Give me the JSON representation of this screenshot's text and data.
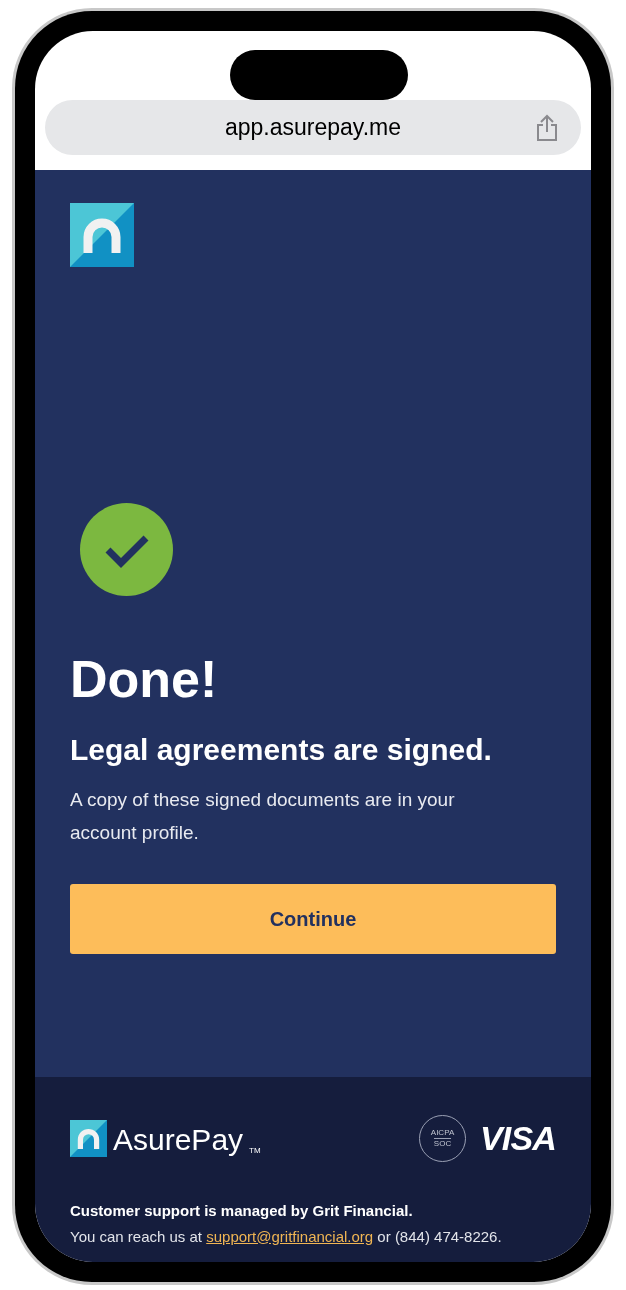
{
  "browser": {
    "url": "app.asurepay.me"
  },
  "confirmation": {
    "title": "Done!",
    "heading": "Legal agreements are signed.",
    "message": "A copy of these signed documents are in your account profile.",
    "button": "Continue"
  },
  "footer": {
    "brand": "AsurePay",
    "trademark": "TM",
    "badge": [
      "AICPA",
      "SOC"
    ],
    "card_network": "VISA",
    "support_title": "Customer support is managed by Grit Financial.",
    "support_before": "You can reach us at ",
    "support_email": "support@gritfinancial.org",
    "support_after": " or (844) 474-8226."
  }
}
